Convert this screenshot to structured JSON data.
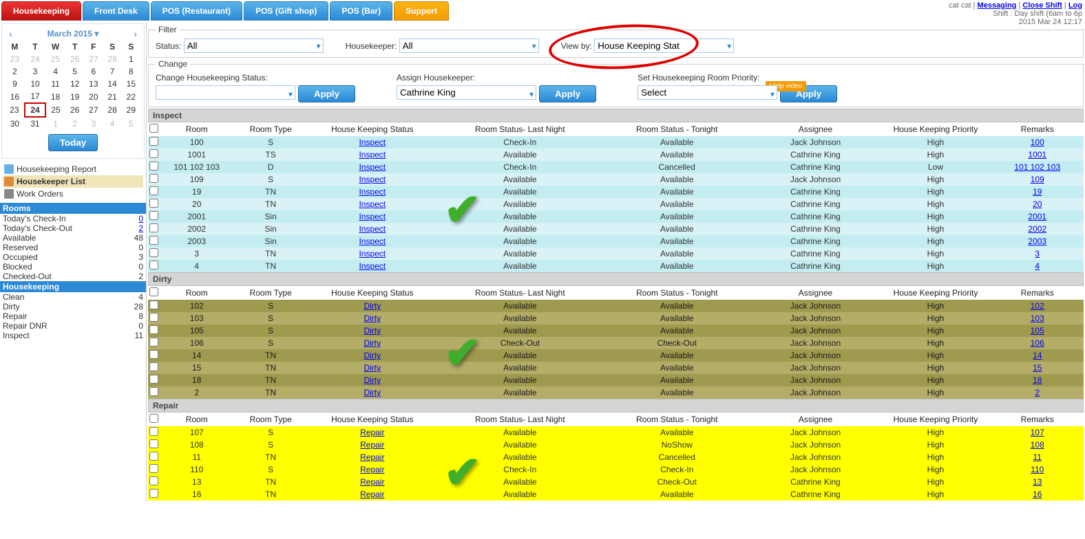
{
  "tabs": [
    "Housekeeping",
    "Front Desk",
    "POS (Restaurant)",
    "POS (Gift shop)",
    "POS (Bar)",
    "Support"
  ],
  "user_line": "cat cat",
  "links": {
    "messaging": "Messaging",
    "close_shift": "Close Shift",
    "log": "Log"
  },
  "shift_line": "Shift : Day shift (6am to 6p",
  "date_line": "2015 Mar 24 12:17",
  "calendar": {
    "title": "March 2015",
    "dow": [
      "M",
      "T",
      "W",
      "T",
      "F",
      "S",
      "S"
    ],
    "weeks": [
      [
        {
          "d": 23,
          "o": true
        },
        {
          "d": 24,
          "o": true
        },
        {
          "d": 25,
          "o": true
        },
        {
          "d": 26,
          "o": true
        },
        {
          "d": 27,
          "o": true
        },
        {
          "d": 28,
          "o": true
        },
        {
          "d": 1
        }
      ],
      [
        {
          "d": 2
        },
        {
          "d": 3
        },
        {
          "d": 4
        },
        {
          "d": 5
        },
        {
          "d": 6
        },
        {
          "d": 7
        },
        {
          "d": 8
        }
      ],
      [
        {
          "d": 9
        },
        {
          "d": 10
        },
        {
          "d": 11
        },
        {
          "d": 12
        },
        {
          "d": 13
        },
        {
          "d": 14
        },
        {
          "d": 15
        }
      ],
      [
        {
          "d": 16
        },
        {
          "d": 17
        },
        {
          "d": 18
        },
        {
          "d": 19
        },
        {
          "d": 20
        },
        {
          "d": 21
        },
        {
          "d": 22
        }
      ],
      [
        {
          "d": 23
        },
        {
          "d": 24,
          "t": true
        },
        {
          "d": 25
        },
        {
          "d": 26
        },
        {
          "d": 27
        },
        {
          "d": 28
        },
        {
          "d": 29
        }
      ],
      [
        {
          "d": 30
        },
        {
          "d": 31
        },
        {
          "d": 1,
          "o": true
        },
        {
          "d": 2,
          "o": true
        },
        {
          "d": 3,
          "o": true
        },
        {
          "d": 4,
          "o": true
        },
        {
          "d": 5,
          "o": true
        }
      ]
    ],
    "today_btn": "Today"
  },
  "side_links": [
    {
      "label": "Housekeeping Report",
      "icon": "#6ab0e8"
    },
    {
      "label": "Housekeeper List",
      "icon": "#e08a3c",
      "active": true
    },
    {
      "label": "Work Orders",
      "icon": "#888"
    }
  ],
  "rooms_header": "Rooms",
  "rooms_stats": [
    {
      "l": "Today's Check-In",
      "v": "0",
      "link": true
    },
    {
      "l": "Today's Check-Out",
      "v": "2",
      "link": true
    },
    {
      "l": "",
      "v": ""
    },
    {
      "l": "Available",
      "v": "48"
    },
    {
      "l": "Reserved",
      "v": "0"
    },
    {
      "l": "Occupied",
      "v": "3"
    },
    {
      "l": "Blocked",
      "v": "0"
    },
    {
      "l": "Checked-Out",
      "v": "2"
    }
  ],
  "hk_header": "Housekeeping",
  "hk_stats": [
    {
      "l": "Clean",
      "v": "4"
    },
    {
      "l": "Dirty",
      "v": "28"
    },
    {
      "l": "Repair",
      "v": "8"
    },
    {
      "l": "Repair DNR",
      "v": "0"
    },
    {
      "l": "Inspect",
      "v": "11"
    }
  ],
  "filter": {
    "legend": "Filter",
    "status_l": "Status:",
    "status_v": "All",
    "hk_l": "Housekeeper:",
    "hk_v": "All",
    "view_l": "View by:",
    "view_v": "House Keeping Stat",
    "help": "Help video"
  },
  "change": {
    "legend": "Change",
    "chs_l": "Change Housekeeping Status:",
    "chs_v": "",
    "ah_l": "Assign Housekeeper:",
    "ah_v": "Cathrine King",
    "pr_l": "Set Housekeeping Room Priority:",
    "pr_v": "Select",
    "apply": "Apply"
  },
  "cols": [
    "Room",
    "Room Type",
    "House Keeping Status",
    "Room Status- Last Night",
    "Room Status - Tonight",
    "Assignee",
    "House Keeping Priority",
    "Remarks"
  ],
  "inspect_h": "Inspect",
  "inspect": [
    {
      "room": "100",
      "type": "S",
      "hks": "Inspect",
      "rsl": "Check-In",
      "rst": "Available",
      "as": "Jack Johnson",
      "pr": "High",
      "rm": "100"
    },
    {
      "room": "1001",
      "type": "TS",
      "hks": "Inspect",
      "rsl": "Available",
      "rst": "Available",
      "as": "Cathrine King",
      "pr": "High",
      "rm": "1001"
    },
    {
      "room": "101 102 103",
      "type": "D",
      "hks": "Inspect",
      "rsl": "Check-In",
      "rst": "Cancelled",
      "as": "Cathrine King",
      "pr": "Low",
      "rm": "101 102 103"
    },
    {
      "room": "109",
      "type": "S",
      "hks": "Inspect",
      "rsl": "Available",
      "rst": "Available",
      "as": "Jack Johnson",
      "pr": "High",
      "rm": "109"
    },
    {
      "room": "19",
      "type": "TN",
      "hks": "Inspect",
      "rsl": "Available",
      "rst": "Available",
      "as": "Cathrine King",
      "pr": "High",
      "rm": "19"
    },
    {
      "room": "20",
      "type": "TN",
      "hks": "Inspect",
      "rsl": "Available",
      "rst": "Available",
      "as": "Cathrine King",
      "pr": "High",
      "rm": "20"
    },
    {
      "room": "2001",
      "type": "Sin",
      "hks": "Inspect",
      "rsl": "Available",
      "rst": "Available",
      "as": "Cathrine King",
      "pr": "High",
      "rm": "2001"
    },
    {
      "room": "2002",
      "type": "Sin",
      "hks": "Inspect",
      "rsl": "Available",
      "rst": "Available",
      "as": "Cathrine King",
      "pr": "High",
      "rm": "2002"
    },
    {
      "room": "2003",
      "type": "Sin",
      "hks": "Inspect",
      "rsl": "Available",
      "rst": "Available",
      "as": "Cathrine King",
      "pr": "High",
      "rm": "2003"
    },
    {
      "room": "3",
      "type": "TN",
      "hks": "Inspect",
      "rsl": "Available",
      "rst": "Available",
      "as": "Cathrine King",
      "pr": "High",
      "rm": "3"
    },
    {
      "room": "4",
      "type": "TN",
      "hks": "Inspect",
      "rsl": "Available",
      "rst": "Available",
      "as": "Cathrine King",
      "pr": "High",
      "rm": "4"
    }
  ],
  "dirty_h": "Dirty",
  "dirty": [
    {
      "room": "102",
      "type": "S",
      "hks": "Dirty",
      "rsl": "Available",
      "rst": "Available",
      "as": "Jack Johnson",
      "pr": "High",
      "rm": "102"
    },
    {
      "room": "103",
      "type": "S",
      "hks": "Dirty",
      "rsl": "Available",
      "rst": "Available",
      "as": "Jack Johnson",
      "pr": "High",
      "rm": "103"
    },
    {
      "room": "105",
      "type": "S",
      "hks": "Dirty",
      "rsl": "Available",
      "rst": "Available",
      "as": "Jack Johnson",
      "pr": "High",
      "rm": "105"
    },
    {
      "room": "106",
      "type": "S",
      "hks": "Dirty",
      "rsl": "Check-Out",
      "rst": "Check-Out",
      "as": "Jack Johnson",
      "pr": "High",
      "rm": "106"
    },
    {
      "room": "14",
      "type": "TN",
      "hks": "Dirty",
      "rsl": "Available",
      "rst": "Available",
      "as": "Jack Johnson",
      "pr": "High",
      "rm": "14"
    },
    {
      "room": "15",
      "type": "TN",
      "hks": "Dirty",
      "rsl": "Available",
      "rst": "Available",
      "as": "Jack Johnson",
      "pr": "High",
      "rm": "15"
    },
    {
      "room": "18",
      "type": "TN",
      "hks": "Dirty",
      "rsl": "Available",
      "rst": "Available",
      "as": "Jack Johnson",
      "pr": "High",
      "rm": "18"
    },
    {
      "room": "2",
      "type": "TN",
      "hks": "Dirty",
      "rsl": "Available",
      "rst": "Available",
      "as": "Jack Johnson",
      "pr": "High",
      "rm": "2"
    }
  ],
  "repair_h": "Repair",
  "repair": [
    {
      "room": "107",
      "type": "S",
      "hks": "Repair",
      "rsl": "Available",
      "rst": "Available",
      "as": "Jack Johnson",
      "pr": "High",
      "rm": "107"
    },
    {
      "room": "108",
      "type": "S",
      "hks": "Repair",
      "rsl": "Available",
      "rst": "NoShow",
      "as": "Jack Johnson",
      "pr": "High",
      "rm": "108"
    },
    {
      "room": "11",
      "type": "TN",
      "hks": "Repair",
      "rsl": "Available",
      "rst": "Cancelled",
      "as": "Jack Johnson",
      "pr": "High",
      "rm": "11"
    },
    {
      "room": "110",
      "type": "S",
      "hks": "Repair",
      "rsl": "Check-In",
      "rst": "Check-In",
      "as": "Jack Johnson",
      "pr": "High",
      "rm": "110"
    },
    {
      "room": "13",
      "type": "TN",
      "hks": "Repair",
      "rsl": "Available",
      "rst": "Check-Out",
      "as": "Cathrine King",
      "pr": "High",
      "rm": "13"
    },
    {
      "room": "16",
      "type": "TN",
      "hks": "Repair",
      "rsl": "Available",
      "rst": "Available",
      "as": "Cathrine King",
      "pr": "High",
      "rm": "16"
    }
  ]
}
